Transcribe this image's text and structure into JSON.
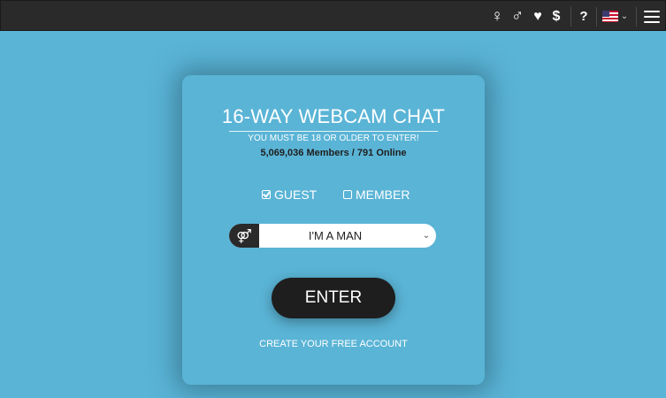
{
  "topbar": {
    "female_icon": "♀",
    "male_icon": "♂",
    "heart_icon": "♥",
    "dollar_icon": "$",
    "help_icon": "?",
    "lang_chevron": "⌄"
  },
  "card": {
    "title": "16-WAY WEBCAM CHAT",
    "age_note": "YOU MUST BE 18 OR OLDER TO ENTER!",
    "stats": "5,069,036 Members / 791 Online",
    "options": {
      "guest": "GUEST",
      "member": "MEMBER"
    },
    "gender_icon": "⚤",
    "gender_select": "I'M A MAN",
    "select_chevron": "⌄",
    "enter": "ENTER",
    "create_account": "CREATE YOUR FREE ACCOUNT"
  },
  "colors": {
    "background": "#5ab4d6",
    "topbar": "#2a2a2a",
    "button": "#1e1e1e"
  }
}
